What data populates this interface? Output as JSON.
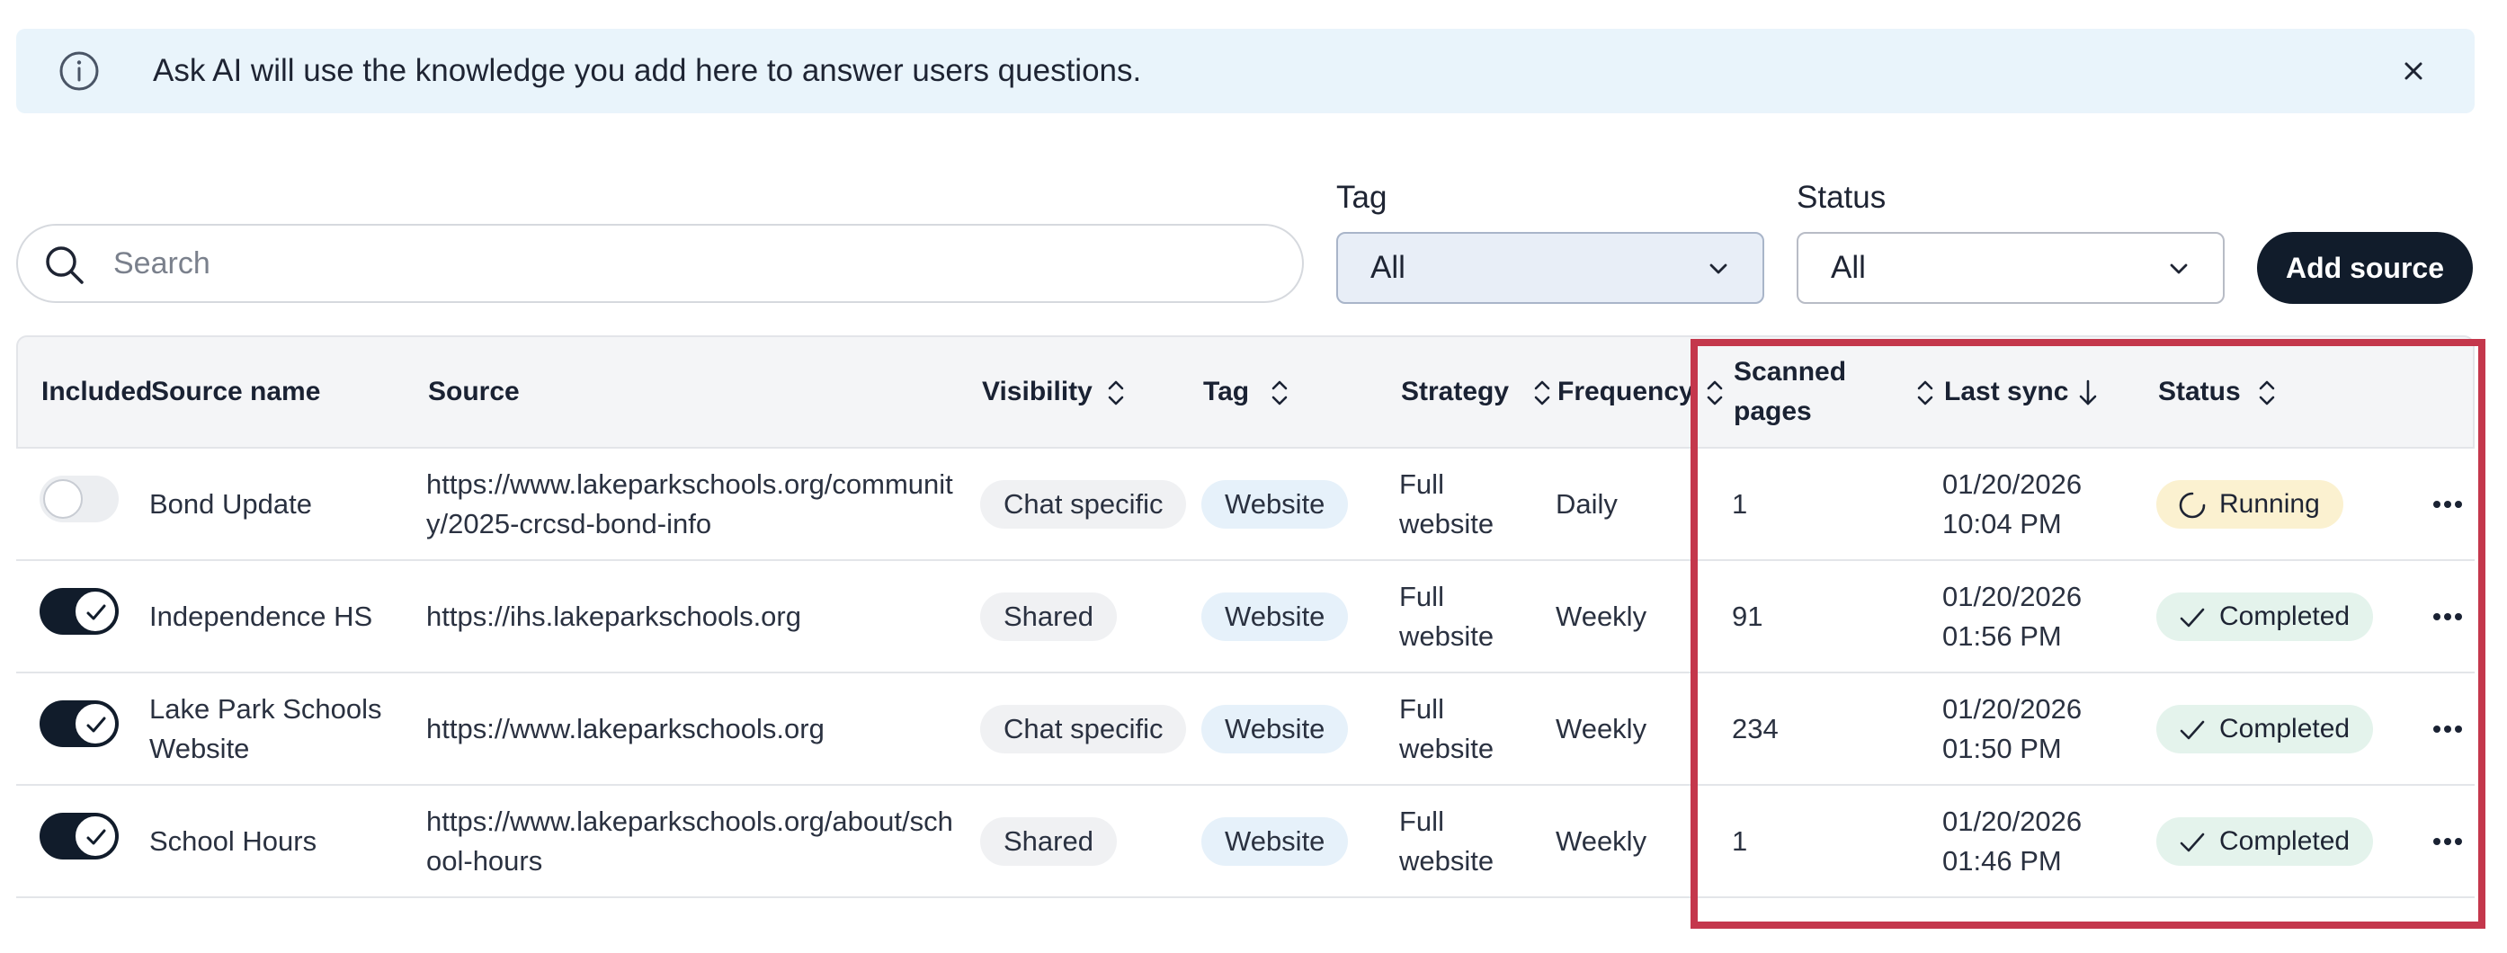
{
  "banner": {
    "text": "Ask AI will use the knowledge you add here to answer users questions.",
    "info_icon": "info-icon",
    "close_icon": "close-icon"
  },
  "search": {
    "placeholder": "Search",
    "value": ""
  },
  "filters": {
    "tag": {
      "label": "Tag",
      "value": "All"
    },
    "status": {
      "label": "Status",
      "value": "All"
    }
  },
  "add_source_label": "Add source",
  "table": {
    "headers": {
      "included": "Included",
      "source_name": "Source name",
      "source": "Source",
      "visibility": "Visibility",
      "tag": "Tag",
      "strategy": "Strategy",
      "frequency": "Frequency",
      "scanned_pages_1": "Scanned",
      "scanned_pages_2": "pages",
      "last_sync": "Last sync",
      "status": "Status"
    },
    "rows": [
      {
        "included": false,
        "name_1": "Bond Update",
        "name_2": "",
        "source_1": "https://www.lakeparkschools.org/communit",
        "source_2": "y/2025-crcsd-bond-info",
        "visibility": "Chat specific",
        "tag": "Website",
        "strategy_1": "Full",
        "strategy_2": "website",
        "frequency": "Daily",
        "scanned_pages": "1",
        "sync_date": "01/20/2026",
        "sync_time": "10:04 PM",
        "status": "Running"
      },
      {
        "included": true,
        "name_1": "Independence HS",
        "name_2": "",
        "source_1": "https://ihs.lakeparkschools.org",
        "source_2": "",
        "visibility": "Shared",
        "tag": "Website",
        "strategy_1": "Full",
        "strategy_2": "website",
        "frequency": "Weekly",
        "scanned_pages": "91",
        "sync_date": "01/20/2026",
        "sync_time": "01:56 PM",
        "status": "Completed"
      },
      {
        "included": true,
        "name_1": "Lake Park Schools",
        "name_2": "Website",
        "source_1": "https://www.lakeparkschools.org",
        "source_2": "",
        "visibility": "Chat specific",
        "tag": "Website",
        "strategy_1": "Full",
        "strategy_2": "website",
        "frequency": "Weekly",
        "scanned_pages": "234",
        "sync_date": "01/20/2026",
        "sync_time": "01:50 PM",
        "status": "Completed"
      },
      {
        "included": true,
        "name_1": "School Hours",
        "name_2": "",
        "source_1": "https://www.lakeparkschools.org/about/sch",
        "source_2": "ool-hours",
        "visibility": "Shared",
        "tag": "Website",
        "strategy_1": "Full",
        "strategy_2": "website",
        "frequency": "Weekly",
        "scanned_pages": "1",
        "sync_date": "01/20/2026",
        "sync_time": "01:46 PM",
        "status": "Completed"
      }
    ]
  },
  "colors": {
    "banner_bg": "#e9f4fb",
    "primary_dark": "#111c2b",
    "highlight_border": "#c4374c",
    "running_bg": "#fbf1d0",
    "completed_bg": "#e4f3ec",
    "tag_pill_bg": "#e6f1fa"
  }
}
